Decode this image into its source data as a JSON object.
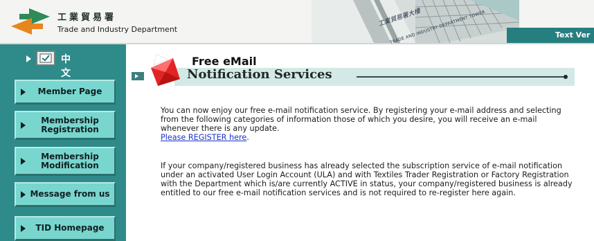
{
  "header": {
    "org_cn": "工業貿易署",
    "org_en": "Trade and Industry Department",
    "banner_text": "工業貿易署大樓",
    "banner_sub": "TRADE AND INDUSTRY DEPARTMENT TOWER",
    "text_version": "Text Ver"
  },
  "sidebar": {
    "language_label": "中文",
    "items": [
      {
        "label": "Member Page"
      },
      {
        "label": "Membership Registration"
      },
      {
        "label": "Membership Modification"
      },
      {
        "label": "Message from us"
      },
      {
        "label": "TID Homepage"
      }
    ]
  },
  "main": {
    "title_top": "Free eMail",
    "title_main": "Notification Services",
    "para1_text": "You can now enjoy our free e-mail notification service. By registering your e-mail address and selecting from the following categories of information those of which you desire, you will receive an e-mail whenever there is any update.",
    "register_link": "Please REGISTER here",
    "para2_text": "If your company/registered business has already selected the subscription service of e-mail notification under an activated User Login Account (ULA) and with Textiles Trader Registration or Factory Registration with the Department which is/are currently ACTIVE in status, your company/registered business is already entitled to our free e-mail notification services and is not required to re-register here again."
  },
  "colors": {
    "sidebar_bg": "#2f8a8a",
    "nav_button_bg": "#78d6cf",
    "link": "#1a33cc",
    "logo_green": "#2e8b57",
    "logo_orange": "#e6861f"
  }
}
